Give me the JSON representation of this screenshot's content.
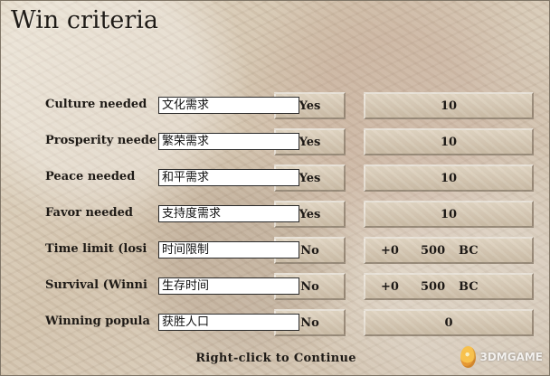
{
  "title": "Win criteria",
  "rows": [
    {
      "label": "Culture needed",
      "overlay": "文化需求",
      "toggle": "Yes",
      "value": "10"
    },
    {
      "label": "Prosperity neede",
      "overlay": "繁荣需求",
      "toggle": "Yes",
      "value": "10"
    },
    {
      "label": "Peace needed",
      "overlay": "和平需求",
      "toggle": "Yes",
      "value": "10"
    },
    {
      "label": "Favor needed",
      "overlay": "支持度需求",
      "toggle": "Yes",
      "value": "10"
    },
    {
      "label": "Time limit (losi",
      "overlay": "时间限制",
      "toggle": "No",
      "delta": "+0",
      "year": "500",
      "era": "BC"
    },
    {
      "label": "Survival (Winni",
      "overlay": "生存时间",
      "toggle": "No",
      "delta": "+0",
      "year": "500",
      "era": "BC"
    },
    {
      "label": "Winning popula",
      "overlay": "获胜人口",
      "toggle": "No",
      "value": "0"
    }
  ],
  "footer": "Right-click to Continue",
  "watermark": "3DMGAME",
  "colors": {
    "panel": "#d8cbb8",
    "text": "#1e1a16"
  }
}
